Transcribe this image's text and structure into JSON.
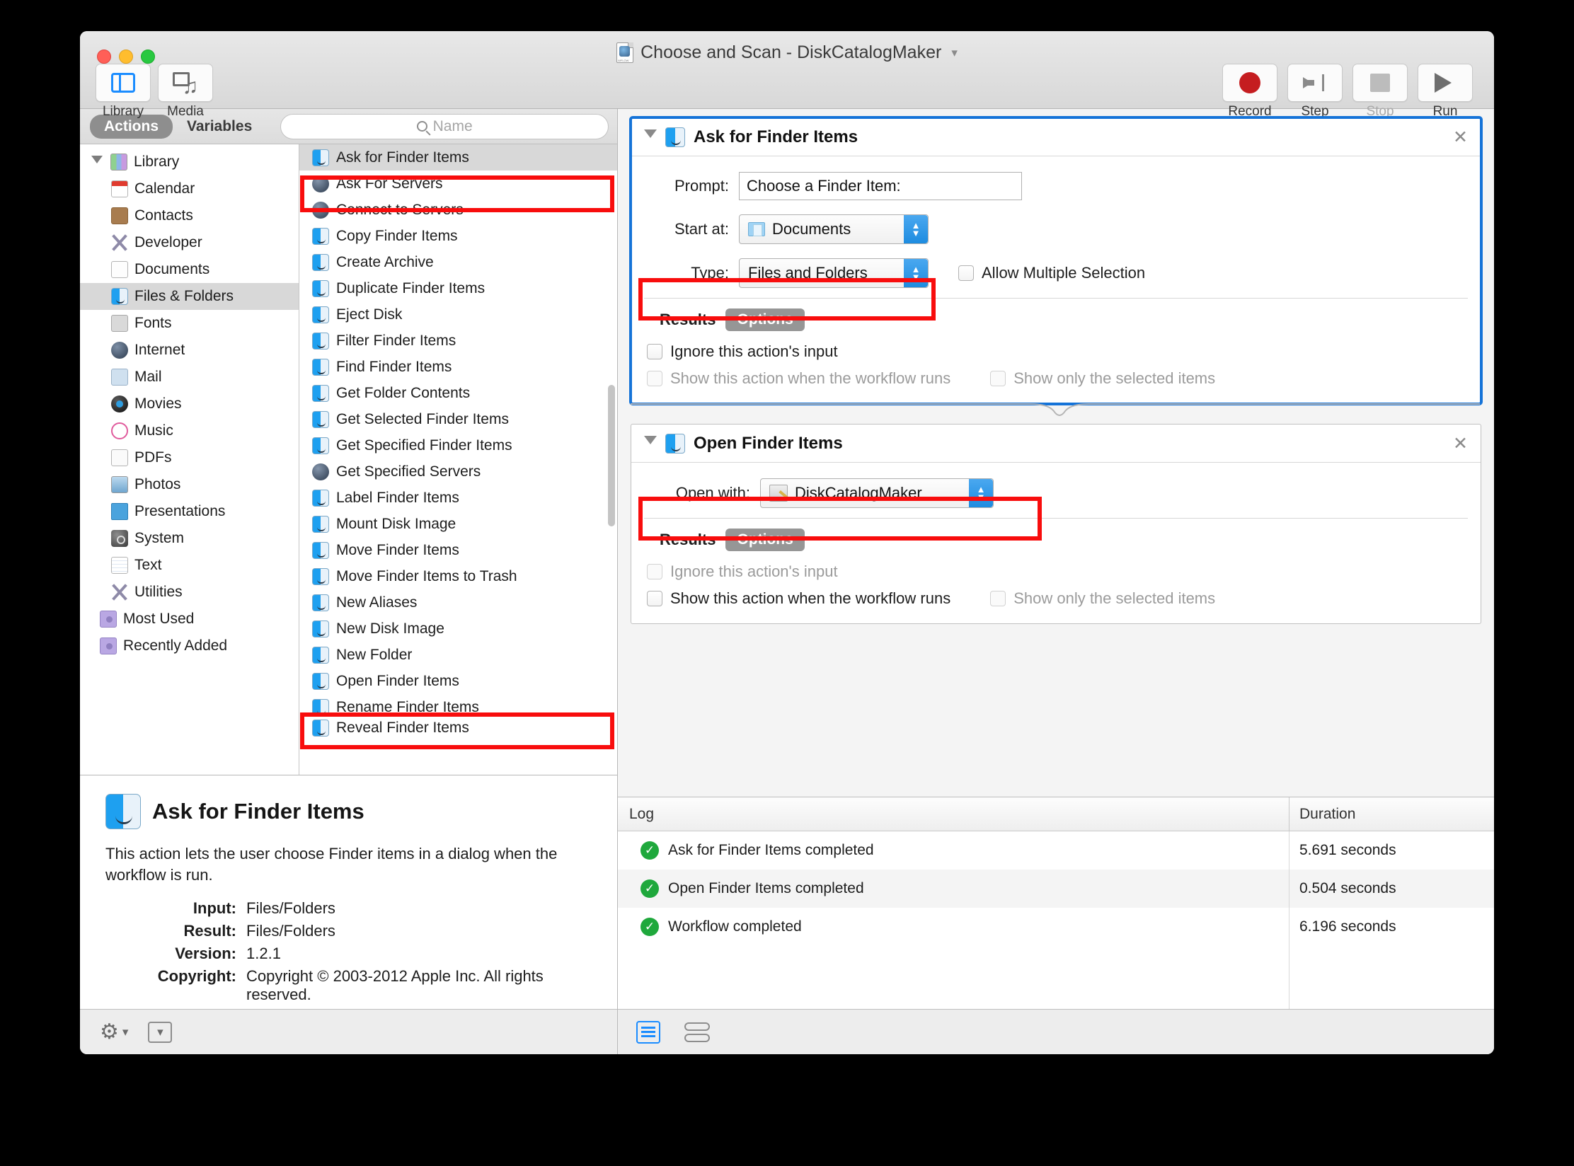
{
  "window": {
    "title": "Choose and Scan - DiskCatalogMaker",
    "title_chevron": "chevron-down"
  },
  "toolbar": {
    "left": [
      {
        "label": "Library",
        "icon": "library-icon",
        "selected": true
      },
      {
        "label": "Media",
        "icon": "media-icon",
        "selected": false
      }
    ],
    "right": [
      {
        "label": "Record",
        "icon": "record-icon",
        "disabled": false
      },
      {
        "label": "Step",
        "icon": "step-icon",
        "disabled": false
      },
      {
        "label": "Stop",
        "icon": "stop-icon",
        "disabled": true
      },
      {
        "label": "Run",
        "icon": "run-icon",
        "disabled": false
      }
    ]
  },
  "library_panel": {
    "tabs": [
      {
        "label": "Actions",
        "active": true
      },
      {
        "label": "Variables",
        "active": false
      }
    ],
    "search": {
      "placeholder": "Name",
      "value": "",
      "icon": "search-icon"
    },
    "tree": [
      {
        "label": "Library",
        "icon": "library-books-icon",
        "level": 0,
        "expanded": true,
        "selected": false
      },
      {
        "label": "Calendar",
        "icon": "calendar-icon",
        "level": 1,
        "selected": false
      },
      {
        "label": "Contacts",
        "icon": "contacts-icon",
        "level": 1,
        "selected": false
      },
      {
        "label": "Developer",
        "icon": "developer-icon",
        "level": 1,
        "selected": false
      },
      {
        "label": "Documents",
        "icon": "documents-icon",
        "level": 1,
        "selected": false
      },
      {
        "label": "Files & Folders",
        "icon": "finder-icon",
        "level": 1,
        "selected": true
      },
      {
        "label": "Fonts",
        "icon": "fonts-icon",
        "level": 1,
        "selected": false
      },
      {
        "label": "Internet",
        "icon": "internet-icon",
        "level": 1,
        "selected": false
      },
      {
        "label": "Mail",
        "icon": "mail-icon",
        "level": 1,
        "selected": false
      },
      {
        "label": "Movies",
        "icon": "movies-icon",
        "level": 1,
        "selected": false
      },
      {
        "label": "Music",
        "icon": "music-icon",
        "level": 1,
        "selected": false
      },
      {
        "label": "PDFs",
        "icon": "pdf-icon",
        "level": 1,
        "selected": false
      },
      {
        "label": "Photos",
        "icon": "photos-icon",
        "level": 1,
        "selected": false
      },
      {
        "label": "Presentations",
        "icon": "presentations-icon",
        "level": 1,
        "selected": false
      },
      {
        "label": "System",
        "icon": "system-icon",
        "level": 1,
        "selected": false
      },
      {
        "label": "Text",
        "icon": "text-icon",
        "level": 1,
        "selected": false
      },
      {
        "label": "Utilities",
        "icon": "utilities-icon",
        "level": 1,
        "selected": false
      },
      {
        "label": "Most Used",
        "icon": "smart-folder-icon",
        "level": 0.5,
        "selected": false
      },
      {
        "label": "Recently Added",
        "icon": "smart-folder-icon",
        "level": 0.5,
        "selected": false
      }
    ],
    "actions": [
      {
        "label": "Ask for Finder Items",
        "icon": "finder-icon",
        "selected": true,
        "highlighted": true
      },
      {
        "label": "Ask For Servers",
        "icon": "globe-icon",
        "selected": false
      },
      {
        "label": "Connect to Servers",
        "icon": "globe-icon",
        "selected": false
      },
      {
        "label": "Copy Finder Items",
        "icon": "finder-icon",
        "selected": false
      },
      {
        "label": "Create Archive",
        "icon": "finder-icon",
        "selected": false
      },
      {
        "label": "Duplicate Finder Items",
        "icon": "finder-icon",
        "selected": false
      },
      {
        "label": "Eject Disk",
        "icon": "finder-icon",
        "selected": false
      },
      {
        "label": "Filter Finder Items",
        "icon": "finder-icon",
        "selected": false
      },
      {
        "label": "Find Finder Items",
        "icon": "finder-icon",
        "selected": false
      },
      {
        "label": "Get Folder Contents",
        "icon": "finder-icon",
        "selected": false
      },
      {
        "label": "Get Selected Finder Items",
        "icon": "finder-icon",
        "selected": false
      },
      {
        "label": "Get Specified Finder Items",
        "icon": "finder-icon",
        "selected": false
      },
      {
        "label": "Get Specified Servers",
        "icon": "globe-icon",
        "selected": false
      },
      {
        "label": "Label Finder Items",
        "icon": "finder-icon",
        "selected": false
      },
      {
        "label": "Mount Disk Image",
        "icon": "finder-icon",
        "selected": false
      },
      {
        "label": "Move Finder Items",
        "icon": "finder-icon",
        "selected": false
      },
      {
        "label": "Move Finder Items to Trash",
        "icon": "finder-icon",
        "selected": false
      },
      {
        "label": "New Aliases",
        "icon": "finder-icon",
        "selected": false
      },
      {
        "label": "New Disk Image",
        "icon": "finder-icon",
        "selected": false
      },
      {
        "label": "New Folder",
        "icon": "finder-icon",
        "selected": false
      },
      {
        "label": "Open Finder Items",
        "icon": "finder-icon",
        "selected": false,
        "highlighted": true
      },
      {
        "label": "Rename Finder Items",
        "icon": "finder-icon",
        "selected": false
      },
      {
        "label": "Reveal Finder Items",
        "icon": "finder-icon",
        "selected": false,
        "clipped": true
      }
    ]
  },
  "info_panel": {
    "title": "Ask for Finder Items",
    "icon": "finder-icon",
    "description": "This action lets the user choose Finder items in a dialog when the workflow is run.",
    "meta": [
      {
        "key": "Input:",
        "value": "Files/Folders"
      },
      {
        "key": "Result:",
        "value": "Files/Folders"
      },
      {
        "key": "Version:",
        "value": "1.2.1"
      },
      {
        "key": "Copyright:",
        "value": "Copyright © 2003-2012 Apple Inc.  All rights reserved."
      }
    ]
  },
  "bottom_bar_left": {
    "gear_label": "⚙",
    "gear_chevron": "∨",
    "disclosure_chevron": "∨"
  },
  "workflow": {
    "actions": [
      {
        "title": "Ask for Finder Items",
        "icon": "finder-icon",
        "focused": true,
        "close_label": "✕",
        "fields": [
          {
            "type": "text",
            "label": "Prompt:",
            "value": "Choose a Finder Item:"
          },
          {
            "type": "popup",
            "label": "Start at:",
            "value": "Documents",
            "icon": "folder-icon"
          },
          {
            "type": "popup",
            "label": "Type:",
            "value": "Files and Folders",
            "highlighted": true,
            "sibling_checkbox": {
              "label": "Allow Multiple Selection",
              "checked": false,
              "disabled": false
            }
          }
        ],
        "results_label": "Results",
        "options_label": "Options",
        "options": [
          {
            "label": "Ignore this action's input",
            "checked": false,
            "disabled": false
          },
          {
            "label": "Show this action when the workflow runs",
            "checked": false,
            "disabled": true
          },
          {
            "label": "Show only the selected items",
            "checked": false,
            "disabled": true
          }
        ]
      },
      {
        "title": "Open Finder Items",
        "icon": "finder-icon",
        "focused": false,
        "close_label": "✕",
        "fields": [
          {
            "type": "popup",
            "label": "Open with:",
            "value": "DiskCatalogMaker",
            "icon": "app-icon",
            "highlighted": true
          }
        ],
        "results_label": "Results",
        "options_label": "Options",
        "options": [
          {
            "label": "Ignore this action's input",
            "checked": false,
            "disabled": true
          },
          {
            "label": "Show this action when the workflow runs",
            "checked": false,
            "disabled": false
          },
          {
            "label": "Show only the selected items",
            "checked": false,
            "disabled": true
          }
        ]
      }
    ]
  },
  "log": {
    "columns": [
      "Log",
      "Duration"
    ],
    "rows": [
      {
        "status": "success-icon",
        "message": "Ask for Finder Items completed",
        "duration": "5.691 seconds"
      },
      {
        "status": "success-icon",
        "message": "Open Finder Items completed",
        "duration": "0.504 seconds"
      },
      {
        "status": "success-icon",
        "message": "Workflow completed",
        "duration": "6.196 seconds"
      }
    ],
    "check_glyph": "✓"
  },
  "bottom_bar_right": {
    "views": [
      {
        "name": "log-list-view",
        "active": true
      },
      {
        "name": "log-split-view",
        "active": false
      }
    ]
  },
  "annotation": {
    "color": "#f80d0d"
  }
}
